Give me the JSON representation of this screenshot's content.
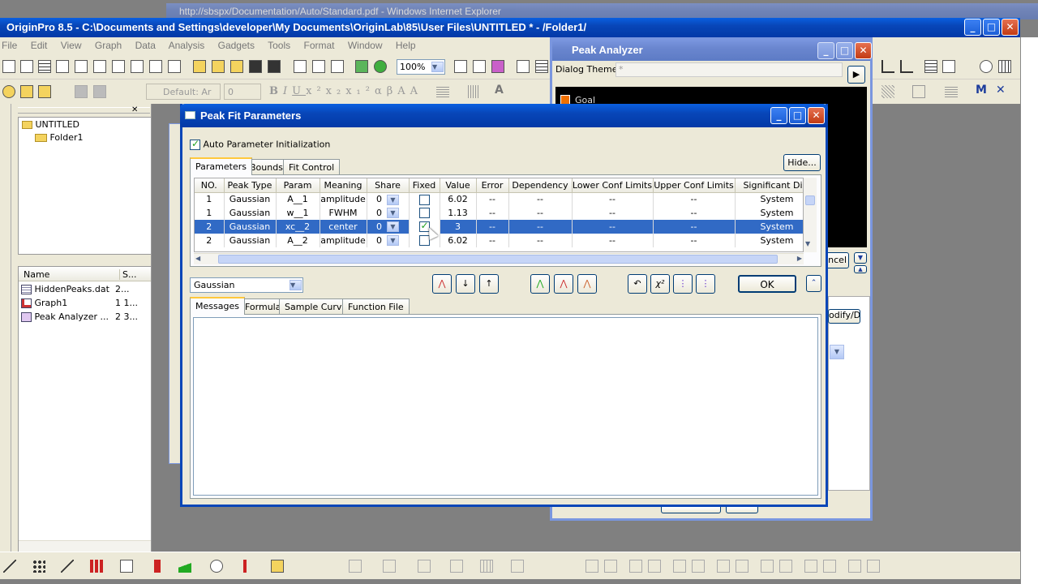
{
  "ie_window": {
    "title": "http://sbspx/Documentation/Auto/Standard.pdf - Windows Internet Explorer"
  },
  "main_window": {
    "title": "OriginPro 8.5 - C:\\Documents and Settings\\developer\\My Documents\\OriginLab\\85\\User Files\\UNTITLED * - /Folder1/",
    "menu": [
      "File",
      "Edit",
      "View",
      "Graph",
      "Data",
      "Analysis",
      "Gadgets",
      "Tools",
      "Format",
      "Window",
      "Help"
    ],
    "zoom": "100%",
    "font_name": "Default: Ar",
    "font_size": "0"
  },
  "project_explorer": {
    "root": "UNTITLED",
    "folder": "Folder1",
    "columns": {
      "name": "Name",
      "size": "S..."
    },
    "items": [
      {
        "name": "HiddenPeaks.dat",
        "size": "2..."
      },
      {
        "name": "Graph1",
        "size": "1 1..."
      },
      {
        "name": "Peak Analyzer ...",
        "size": "2 3..."
      }
    ]
  },
  "peak_analyzer": {
    "title": "Peak Analyzer",
    "dialog_theme_label": "Dialog Theme",
    "dialog_theme_value": "*",
    "goal_label": "Goal",
    "cancel_partial": "ncel",
    "modify_partial": "odify/D"
  },
  "dialog": {
    "title": "Peak Fit Parameters",
    "auto_init_label": "Auto Parameter Initialization",
    "auto_init_checked": true,
    "hide_button": "Hide...",
    "tabs": [
      "Parameters",
      "Bounds",
      "Fit Control"
    ],
    "columns": [
      "NO.",
      "Peak Type",
      "Param",
      "Meaning",
      "Share",
      "Fixed",
      "Value",
      "Error",
      "Dependency",
      "Lower Conf Limits",
      "Upper Conf Limits",
      "Significant Digi"
    ],
    "rows": [
      {
        "no": "1",
        "type": "Gaussian",
        "param": "A__1",
        "meaning": "amplitude",
        "share": "0",
        "fixed": false,
        "value": "6.02",
        "error": "--",
        "dep": "--",
        "lcl": "--",
        "ucl": "--",
        "sig": "System",
        "selected": false
      },
      {
        "no": "1",
        "type": "Gaussian",
        "param": "w__1",
        "meaning": "FWHM",
        "share": "0",
        "fixed": false,
        "value": "1.13",
        "error": "--",
        "dep": "--",
        "lcl": "--",
        "ucl": "--",
        "sig": "System",
        "selected": false
      },
      {
        "no": "2",
        "type": "Gaussian",
        "param": "xc__2",
        "meaning": "center",
        "share": "0",
        "fixed": true,
        "value": "3",
        "error": "--",
        "dep": "--",
        "lcl": "--",
        "ucl": "--",
        "sig": "System",
        "selected": true
      },
      {
        "no": "2",
        "type": "Gaussian",
        "param": "A__2",
        "meaning": "amplitude",
        "share": "0",
        "fixed": false,
        "value": "6.02",
        "error": "--",
        "dep": "--",
        "lcl": "--",
        "ucl": "--",
        "sig": "System",
        "selected": false
      }
    ],
    "function_select": "Gaussian",
    "ok_button": "OK",
    "bottom_tabs": [
      "Messages",
      "Formula",
      "Sample Curve",
      "Function File"
    ],
    "messages_text": ""
  },
  "colors": {
    "selection": "#316ac5",
    "xp_title": "#0846b8",
    "face": "#ece9d8"
  }
}
